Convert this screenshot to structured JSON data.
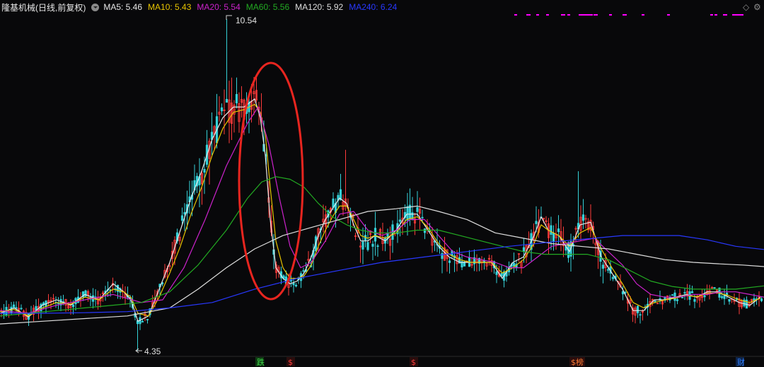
{
  "header": {
    "title": "隆基机械(日线,前复权)",
    "ma": [
      {
        "label": "MA5:",
        "value": "5.46",
        "color": "#e8e8e8"
      },
      {
        "label": "MA10:",
        "value": "5.43",
        "color": "#e7c400"
      },
      {
        "label": "MA20:",
        "value": "5.54",
        "color": "#cc22cc"
      },
      {
        "label": "MA60:",
        "value": "5.56",
        "color": "#22aa22"
      },
      {
        "label": "MA120:",
        "value": "5.92",
        "color": "#dedede"
      },
      {
        "label": "MA240:",
        "value": "6.24",
        "color": "#2838ff"
      }
    ]
  },
  "icons": {
    "right1": "diamond-outline-icon",
    "right2": "gear-icon"
  },
  "chart_data": {
    "type": "candlestick",
    "ylim": [
      4.0,
      11.0
    ],
    "high_label": "10.54",
    "low_label": "4.35",
    "colors": {
      "up": "#ff3b3b",
      "down": "#35d1d8",
      "marker": "#ff00ff",
      "circle": "#e8251f"
    },
    "events": [
      "跌",
      "$",
      "$",
      "$榜",
      "财"
    ],
    "event_colors": [
      "#3fd24a",
      "#ff3b3b",
      "#ff3b3b",
      "#ff7a33",
      "#2f7fff"
    ],
    "series": [
      {
        "name": "MA5",
        "color": "#e8e8e8",
        "x": [
          0,
          20,
          40,
          60,
          80,
          100,
          120,
          140,
          160,
          175,
          185,
          195,
          210,
          225,
          240,
          255,
          270,
          285,
          300,
          315,
          330,
          345,
          360,
          368,
          375,
          382,
          390,
          400,
          410,
          420,
          430,
          440,
          450,
          460,
          470,
          480,
          490,
          500,
          510,
          520,
          530,
          545,
          560,
          575,
          590,
          605,
          620,
          635,
          650,
          665,
          680,
          695,
          710,
          725,
          740,
          755,
          765,
          775,
          790,
          805,
          820,
          835,
          850,
          865,
          880,
          895,
          910,
          925,
          940,
          955,
          970,
          985,
          1000,
          1015,
          1030,
          1045,
          1060,
          1075
        ],
        "values": [
          5.05,
          5.15,
          4.98,
          5.2,
          5.3,
          5.2,
          5.4,
          5.3,
          5.6,
          5.45,
          5.3,
          4.9,
          5.0,
          5.5,
          6.0,
          6.6,
          7.2,
          7.7,
          8.3,
          8.7,
          8.9,
          8.9,
          9.05,
          8.7,
          8.0,
          6.8,
          5.9,
          5.7,
          5.6,
          5.65,
          5.8,
          6.1,
          6.5,
          6.8,
          7.0,
          7.2,
          7.1,
          6.7,
          6.4,
          6.4,
          6.5,
          6.4,
          6.6,
          6.9,
          6.9,
          6.6,
          6.3,
          6.1,
          6.0,
          6.0,
          6.0,
          6.0,
          5.7,
          6.0,
          6.1,
          6.5,
          6.85,
          6.6,
          6.5,
          6.2,
          6.7,
          6.75,
          6.1,
          5.8,
          5.5,
          5.1,
          5.1,
          5.3,
          5.3,
          5.35,
          5.4,
          5.35,
          5.45,
          5.45,
          5.35,
          5.25,
          5.2,
          5.35
        ]
      },
      {
        "name": "MA10",
        "color": "#e7c400",
        "x": [
          0,
          20,
          40,
          60,
          80,
          100,
          120,
          140,
          160,
          175,
          185,
          195,
          210,
          225,
          240,
          255,
          270,
          285,
          300,
          315,
          330,
          345,
          360,
          368,
          375,
          382,
          390,
          400,
          410,
          420,
          430,
          440,
          450,
          460,
          470,
          480,
          490,
          500,
          510,
          520,
          530,
          545,
          560,
          575,
          590,
          605,
          620,
          635,
          650,
          665,
          680,
          695,
          710,
          725,
          740,
          755,
          765,
          775,
          790,
          805,
          820,
          835,
          850,
          865,
          880,
          895,
          910,
          925,
          940,
          955,
          970,
          985,
          1000,
          1015,
          1030,
          1045,
          1060,
          1075
        ],
        "values": [
          5.08,
          5.12,
          5.0,
          5.15,
          5.25,
          5.22,
          5.35,
          5.3,
          5.5,
          5.45,
          5.35,
          5.05,
          5.0,
          5.35,
          5.8,
          6.3,
          6.9,
          7.4,
          8.0,
          8.5,
          8.8,
          8.85,
          8.95,
          8.8,
          8.4,
          7.4,
          6.4,
          5.9,
          5.7,
          5.7,
          5.75,
          5.95,
          6.3,
          6.6,
          6.85,
          7.05,
          7.05,
          6.8,
          6.5,
          6.45,
          6.5,
          6.45,
          6.55,
          6.8,
          6.85,
          6.65,
          6.35,
          6.15,
          6.05,
          6.0,
          6.0,
          6.0,
          5.8,
          5.9,
          6.05,
          6.35,
          6.7,
          6.6,
          6.5,
          6.3,
          6.55,
          6.65,
          6.25,
          5.9,
          5.6,
          5.25,
          5.15,
          5.25,
          5.3,
          5.33,
          5.38,
          5.36,
          5.42,
          5.43,
          5.38,
          5.3,
          5.25,
          5.33
        ]
      },
      {
        "name": "MA20",
        "color": "#cc22cc",
        "x": [
          0,
          40,
          80,
          120,
          160,
          200,
          230,
          260,
          290,
          320,
          350,
          365,
          380,
          395,
          410,
          425,
          440,
          460,
          480,
          500,
          520,
          540,
          560,
          580,
          600,
          620,
          640,
          660,
          680,
          700,
          720,
          740,
          760,
          780,
          800,
          820,
          840,
          860,
          880,
          900,
          920,
          940,
          960,
          980,
          1000,
          1020,
          1040,
          1060,
          1080
        ],
        "values": [
          5.1,
          5.05,
          5.2,
          5.3,
          5.4,
          5.25,
          5.3,
          5.9,
          6.8,
          7.8,
          8.6,
          8.9,
          8.2,
          7.2,
          6.3,
          5.9,
          6.0,
          6.4,
          6.9,
          6.95,
          6.6,
          6.5,
          6.6,
          6.8,
          6.8,
          6.5,
          6.2,
          6.1,
          6.05,
          6.0,
          5.9,
          5.9,
          6.1,
          6.3,
          6.35,
          6.4,
          6.45,
          6.2,
          5.95,
          5.6,
          5.4,
          5.35,
          5.35,
          5.4,
          5.4,
          5.45,
          5.45,
          5.4,
          5.35
        ]
      },
      {
        "name": "MA60",
        "color": "#22aa22",
        "x": [
          0,
          40,
          80,
          120,
          160,
          200,
          240,
          280,
          320,
          350,
          370,
          390,
          410,
          430,
          450,
          470,
          490,
          510,
          530,
          560,
          590,
          620,
          650,
          680,
          710,
          740,
          770,
          800,
          830,
          860,
          890,
          920,
          950,
          980,
          1010,
          1040,
          1080
        ],
        "values": [
          5.0,
          5.05,
          5.1,
          5.15,
          5.2,
          5.25,
          5.45,
          5.95,
          6.6,
          7.2,
          7.5,
          7.6,
          7.55,
          7.4,
          7.1,
          6.85,
          6.7,
          6.6,
          6.55,
          6.55,
          6.6,
          6.6,
          6.5,
          6.4,
          6.3,
          6.2,
          6.15,
          6.15,
          6.15,
          6.05,
          5.85,
          5.65,
          5.55,
          5.5,
          5.5,
          5.5,
          5.56
        ]
      },
      {
        "name": "MA120",
        "color": "#dedede",
        "x": [
          0,
          60,
          120,
          180,
          240,
          280,
          320,
          360,
          400,
          440,
          480,
          520,
          560,
          590,
          620,
          660,
          700,
          740,
          780,
          820,
          860,
          900,
          940,
          980,
          1020,
          1050,
          1080
        ],
        "values": [
          4.85,
          4.9,
          4.95,
          5.0,
          5.15,
          5.5,
          5.9,
          6.25,
          6.5,
          6.65,
          6.8,
          6.95,
          7.0,
          7.05,
          6.95,
          6.8,
          6.55,
          6.45,
          6.35,
          6.3,
          6.25,
          6.15,
          6.05,
          6.0,
          5.97,
          5.95,
          5.92
        ]
      },
      {
        "name": "MA240",
        "color": "#2838ff",
        "x": [
          0,
          60,
          120,
          180,
          240,
          300,
          360,
          420,
          480,
          540,
          600,
          660,
          720,
          780,
          840,
          880,
          920,
          960,
          1000,
          1040,
          1080
        ],
        "values": [
          5.05,
          5.05,
          5.06,
          5.08,
          5.15,
          5.25,
          5.5,
          5.7,
          5.85,
          6.0,
          6.1,
          6.2,
          6.3,
          6.38,
          6.45,
          6.5,
          6.5,
          6.5,
          6.42,
          6.3,
          6.24
        ]
      }
    ]
  }
}
